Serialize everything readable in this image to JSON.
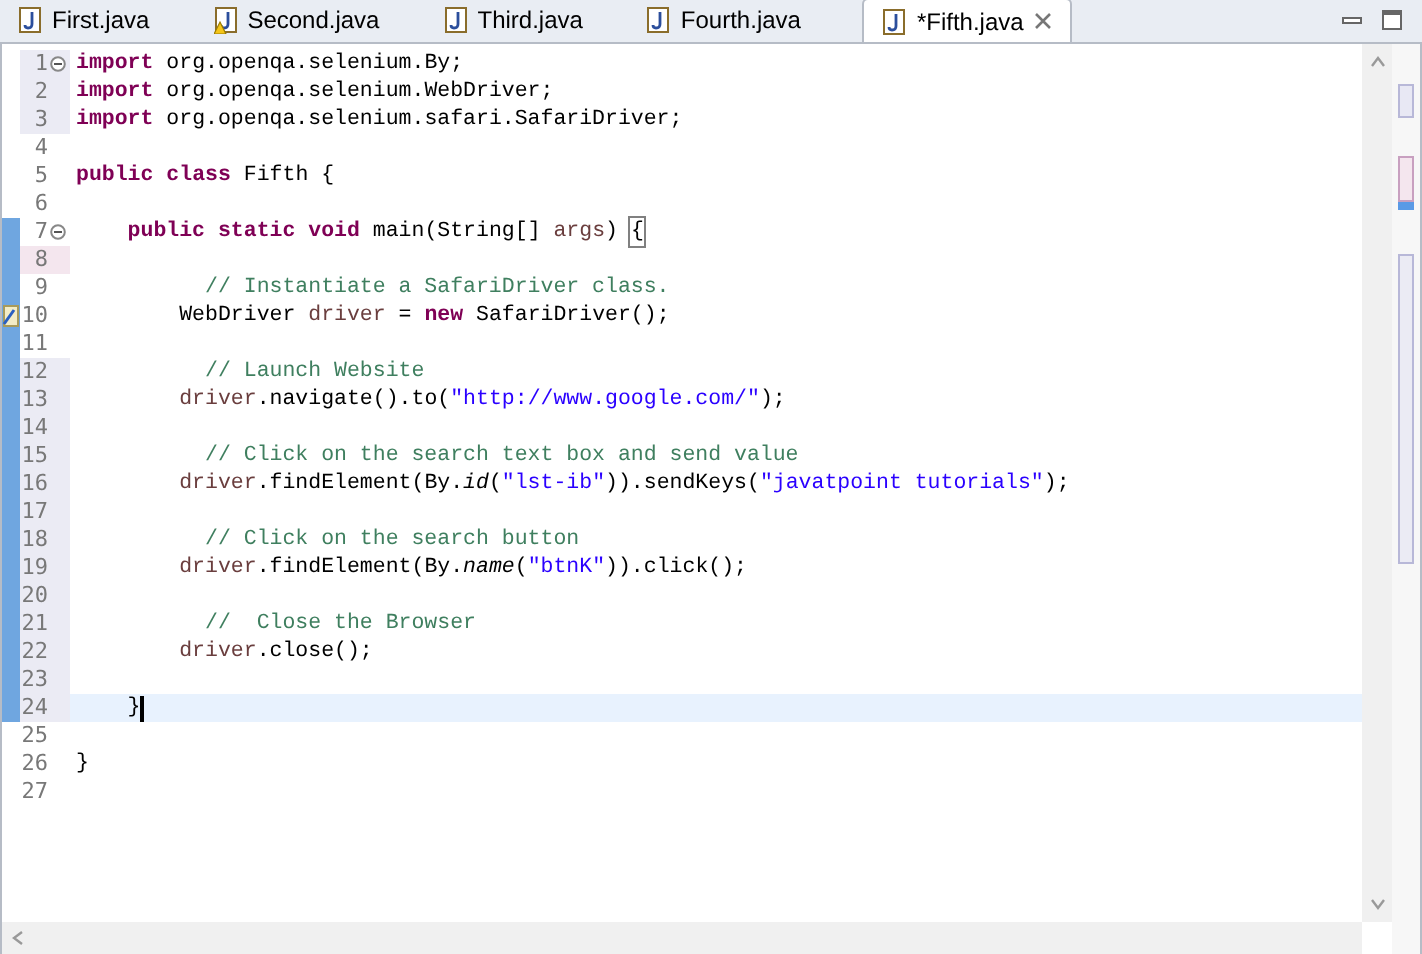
{
  "tabs": [
    {
      "label": "First.java",
      "selected": false,
      "warning": false
    },
    {
      "label": "Second.java",
      "selected": false,
      "warning": true
    },
    {
      "label": "Third.java",
      "selected": false,
      "warning": false
    },
    {
      "label": "Fourth.java",
      "selected": false,
      "warning": false
    },
    {
      "label": "*Fifth.java",
      "selected": true,
      "warning": false
    }
  ],
  "editor": {
    "lines": [
      {
        "number": "1",
        "fold": true,
        "ruler": false,
        "changed": true,
        "added": false,
        "annotation": false,
        "current": false,
        "segments": [
          {
            "kind": "keyword",
            "text": "import"
          },
          {
            "kind": "plain",
            "text": " org.openqa.selenium.By;"
          }
        ]
      },
      {
        "number": "2",
        "fold": false,
        "ruler": false,
        "changed": true,
        "added": false,
        "annotation": false,
        "current": false,
        "segments": [
          {
            "kind": "keyword",
            "text": "import"
          },
          {
            "kind": "plain",
            "text": " org.openqa.selenium.WebDriver;"
          }
        ]
      },
      {
        "number": "3",
        "fold": false,
        "ruler": false,
        "changed": true,
        "added": false,
        "annotation": false,
        "current": false,
        "segments": [
          {
            "kind": "keyword",
            "text": "import"
          },
          {
            "kind": "plain",
            "text": " org.openqa.selenium.safari.SafariDriver;"
          }
        ]
      },
      {
        "number": "4",
        "fold": false,
        "ruler": false,
        "changed": false,
        "added": false,
        "annotation": false,
        "current": false
      },
      {
        "number": "5",
        "fold": false,
        "ruler": false,
        "changed": false,
        "added": false,
        "annotation": false,
        "current": false,
        "segments": [
          {
            "kind": "keyword",
            "text": "public "
          },
          {
            "kind": "keyword",
            "text": "class"
          },
          {
            "kind": "plain",
            "text": " Fifth {"
          }
        ]
      },
      {
        "number": "6",
        "fold": false,
        "ruler": false,
        "changed": false,
        "added": false,
        "annotation": false,
        "current": false
      },
      {
        "number": "7",
        "fold": true,
        "ruler": true,
        "changed": false,
        "added": false,
        "annotation": false,
        "current": false,
        "segments": [
          {
            "kind": "keyword",
            "text": "    public "
          },
          {
            "kind": "keyword",
            "text": "static "
          },
          {
            "kind": "keyword",
            "text": "void"
          },
          {
            "kind": "plain",
            "text": " main(String[] "
          },
          {
            "kind": "variable",
            "text": "args"
          },
          {
            "kind": "plain",
            "text": ") "
          },
          {
            "kind": "bracket",
            "text": "{"
          }
        ]
      },
      {
        "number": "8",
        "fold": false,
        "ruler": true,
        "changed": false,
        "added": true,
        "annotation": false,
        "current": false
      },
      {
        "number": "9",
        "fold": false,
        "ruler": true,
        "changed": false,
        "added": false,
        "annotation": false,
        "current": false,
        "segments": [
          {
            "kind": "comment",
            "text": "          // Instantiate a SafariDriver class."
          }
        ]
      },
      {
        "number": "10",
        "fold": false,
        "ruler": true,
        "changed": false,
        "added": false,
        "annotation": true,
        "current": false,
        "segments": [
          {
            "kind": "plain",
            "text": "        WebDriver "
          },
          {
            "kind": "variable",
            "text": "driver"
          },
          {
            "kind": "plain",
            "text": " = "
          },
          {
            "kind": "keyword",
            "text": "new"
          },
          {
            "kind": "plain",
            "text": " SafariDriver();"
          }
        ]
      },
      {
        "number": "11",
        "fold": false,
        "ruler": true,
        "changed": false,
        "added": false,
        "annotation": false,
        "current": false
      },
      {
        "number": "12",
        "fold": false,
        "ruler": true,
        "changed": true,
        "added": false,
        "annotation": false,
        "current": false,
        "segments": [
          {
            "kind": "comment",
            "text": "          // Launch Website"
          }
        ]
      },
      {
        "number": "13",
        "fold": false,
        "ruler": true,
        "changed": true,
        "added": false,
        "annotation": false,
        "current": false,
        "segments": [
          {
            "kind": "variable",
            "text": "        driver"
          },
          {
            "kind": "plain",
            "text": ".navigate().to("
          },
          {
            "kind": "string",
            "text": "\"http://www.google.com/\""
          },
          {
            "kind": "plain",
            "text": ");"
          }
        ]
      },
      {
        "number": "14",
        "fold": false,
        "ruler": true,
        "changed": true,
        "added": false,
        "annotation": false,
        "current": false
      },
      {
        "number": "15",
        "fold": false,
        "ruler": true,
        "changed": true,
        "added": false,
        "annotation": false,
        "current": false,
        "segments": [
          {
            "kind": "comment",
            "text": "          // Click on the search text box and send value"
          }
        ]
      },
      {
        "number": "16",
        "fold": false,
        "ruler": true,
        "changed": true,
        "added": false,
        "annotation": false,
        "current": false,
        "segments": [
          {
            "kind": "variable",
            "text": "        driver"
          },
          {
            "kind": "plain",
            "text": ".findElement(By."
          },
          {
            "kind": "italic",
            "text": "id"
          },
          {
            "kind": "plain",
            "text": "("
          },
          {
            "kind": "string",
            "text": "\"lst-ib\""
          },
          {
            "kind": "plain",
            "text": ")).sendKeys("
          },
          {
            "kind": "string",
            "text": "\"javatpoint tutorials\""
          },
          {
            "kind": "plain",
            "text": ");"
          }
        ]
      },
      {
        "number": "17",
        "fold": false,
        "ruler": true,
        "changed": true,
        "added": false,
        "annotation": false,
        "current": false
      },
      {
        "number": "18",
        "fold": false,
        "ruler": true,
        "changed": true,
        "added": false,
        "annotation": false,
        "current": false,
        "segments": [
          {
            "kind": "comment",
            "text": "          // Click on the search button"
          }
        ]
      },
      {
        "number": "19",
        "fold": false,
        "ruler": true,
        "changed": true,
        "added": false,
        "annotation": false,
        "current": false,
        "segments": [
          {
            "kind": "variable",
            "text": "        driver"
          },
          {
            "kind": "plain",
            "text": ".findElement(By."
          },
          {
            "kind": "italic",
            "text": "name"
          },
          {
            "kind": "plain",
            "text": "("
          },
          {
            "kind": "string",
            "text": "\"btnK\""
          },
          {
            "kind": "plain",
            "text": ")).click();"
          }
        ]
      },
      {
        "number": "20",
        "fold": false,
        "ruler": true,
        "changed": true,
        "added": false,
        "annotation": false,
        "current": false
      },
      {
        "number": "21",
        "fold": false,
        "ruler": true,
        "changed": true,
        "added": false,
        "annotation": false,
        "current": false,
        "segments": [
          {
            "kind": "comment",
            "text": "          //  Close the Browser"
          }
        ]
      },
      {
        "number": "22",
        "fold": false,
        "ruler": true,
        "changed": true,
        "added": false,
        "annotation": false,
        "current": false,
        "segments": [
          {
            "kind": "variable",
            "text": "        driver"
          },
          {
            "kind": "plain",
            "text": ".close();"
          }
        ]
      },
      {
        "number": "23",
        "fold": false,
        "ruler": true,
        "changed": true,
        "added": false,
        "annotation": false,
        "current": false
      },
      {
        "number": "24",
        "fold": false,
        "ruler": true,
        "changed": true,
        "added": false,
        "annotation": false,
        "current": true,
        "segments": [
          {
            "kind": "plain",
            "text": "    }"
          }
        ]
      },
      {
        "number": "25",
        "fold": false,
        "ruler": false,
        "changed": false,
        "added": false,
        "annotation": false,
        "current": false
      },
      {
        "number": "26",
        "fold": false,
        "ruler": false,
        "changed": false,
        "added": false,
        "annotation": false,
        "current": false,
        "segments": [
          {
            "kind": "plain",
            "text": "}"
          }
        ]
      },
      {
        "number": "27",
        "fold": false,
        "ruler": false,
        "changed": false,
        "added": false,
        "annotation": false,
        "current": false
      }
    ]
  }
}
